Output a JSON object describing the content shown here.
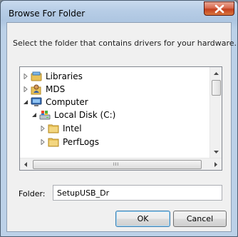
{
  "dialog": {
    "title": "Browse For Folder",
    "prompt": "Select the folder that contains drivers for your hardware."
  },
  "tree": {
    "items": [
      {
        "label": "Libraries",
        "icon": "libraries-icon",
        "expander": "collapsed"
      },
      {
        "label": "MDS",
        "icon": "user-folder-icon",
        "expander": "collapsed"
      },
      {
        "label": "Computer",
        "icon": "computer-icon",
        "expander": "expanded"
      },
      {
        "label": "Local Disk (C:)",
        "icon": "drive-icon",
        "expander": "expanded"
      },
      {
        "label": "Intel",
        "icon": "folder-icon",
        "expander": "collapsed"
      },
      {
        "label": "PerfLogs",
        "icon": "folder-icon",
        "expander": "collapsed"
      }
    ],
    "hscroll_grip": "III"
  },
  "folder": {
    "label": "Folder:",
    "value": "SetupUSB_Dr"
  },
  "buttons": {
    "ok": "OK",
    "cancel": "Cancel"
  },
  "colors": {
    "title_gradient_top": "#c9daee",
    "close_button_red": "#c3401f",
    "dialog_background": "#f0f0f0",
    "folder_icon_yellow": "#e8c25a"
  }
}
